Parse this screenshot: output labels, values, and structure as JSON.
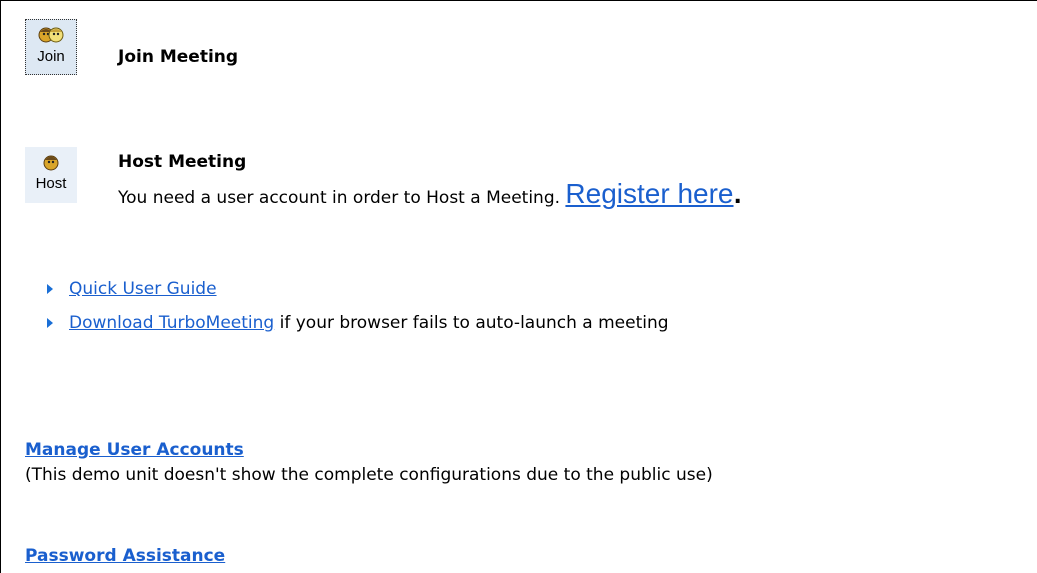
{
  "join": {
    "icon_label": "Join",
    "title": "Join Meeting",
    "icon": "two-people-icon"
  },
  "host": {
    "icon_label": "Host",
    "title": "Host Meeting",
    "description": "You need a user account in order to Host a Meeting.",
    "register_link": "Register here",
    "register_suffix": ".",
    "icon": "person-icon"
  },
  "links": [
    {
      "label": "Quick User Guide",
      "suffix": ""
    },
    {
      "label": "Download TurboMeeting",
      "suffix": " if your browser fails to auto-launch a meeting"
    }
  ],
  "manage": {
    "link": "Manage User Accounts",
    "note": "(This demo unit doesn't show the complete configurations due to the public use)"
  },
  "password": {
    "link": "Password Assistance"
  },
  "colors": {
    "link": "#1a5fce",
    "bullet": "#1a6fd6",
    "icon_bg": "#dde8f3"
  }
}
